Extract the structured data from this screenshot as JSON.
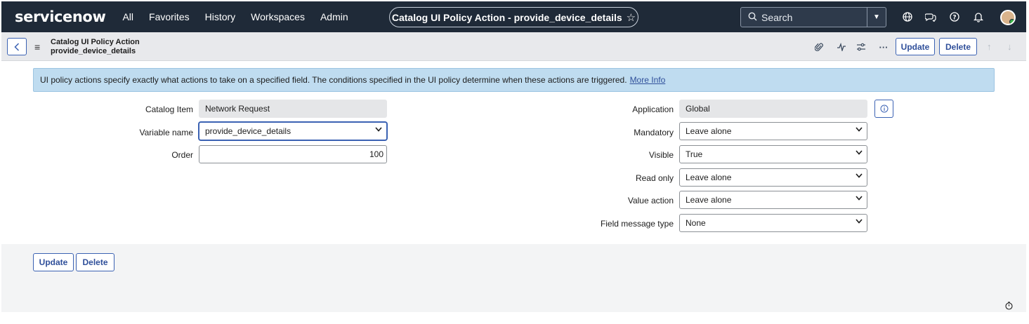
{
  "nav": {
    "logo": "servicenow",
    "links": [
      "All",
      "Favorites",
      "History",
      "Workspaces",
      "Admin"
    ],
    "record_pill": "Catalog UI Policy Action - provide_device_details",
    "search_placeholder": "Search",
    "icons": [
      "globe-icon",
      "chat-icon",
      "help-icon",
      "bell-icon"
    ]
  },
  "header": {
    "title_line1": "Catalog UI Policy Action",
    "title_line2": "provide_device_details",
    "update_label": "Update",
    "delete_label": "Delete"
  },
  "banner": {
    "text": "UI policy actions specify exactly what actions to take on a specified field. The conditions specified in the UI policy determine when these actions are triggered.",
    "link": "More Info"
  },
  "form": {
    "left": {
      "catalog_item_label": "Catalog Item",
      "catalog_item_value": "Network Request",
      "variable_name_label": "Variable name",
      "variable_name_value": "provide_device_details",
      "order_label": "Order",
      "order_value": "100"
    },
    "right": {
      "application_label": "Application",
      "application_value": "Global",
      "mandatory_label": "Mandatory",
      "mandatory_value": "Leave alone",
      "visible_label": "Visible",
      "visible_value": "True",
      "read_only_label": "Read only",
      "read_only_value": "Leave alone",
      "value_action_label": "Value action",
      "value_action_value": "Leave alone",
      "field_message_type_label": "Field message type",
      "field_message_type_value": "None"
    }
  },
  "footer": {
    "update_label": "Update",
    "delete_label": "Delete"
  },
  "colors": {
    "nav_bg": "#1f2a38",
    "accent": "#3b62b3",
    "banner_bg": "#bfdcf0"
  }
}
